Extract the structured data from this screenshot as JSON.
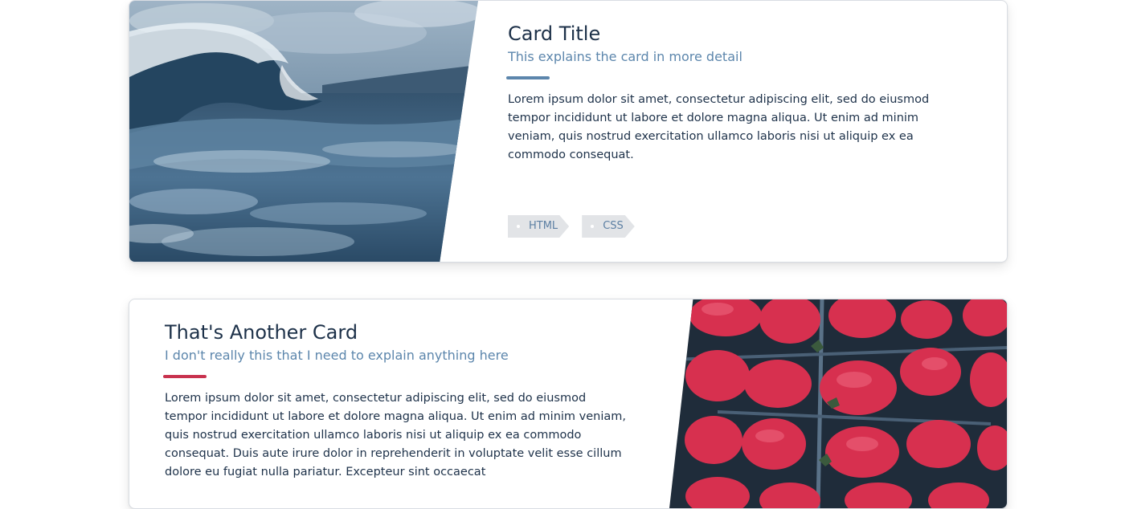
{
  "cards": [
    {
      "title": "Card Title",
      "subtitle": "This explains the card in more detail",
      "description": "Lorem ipsum dolor sit amet, consectetur adipiscing elit, sed do eiusmod tempor incididunt ut labore et dolore magna aliqua. Ut enim ad minim veniam, quis nostrud exercitation ullamco laboris nisi ut aliquip ex ea commodo consequat.",
      "tags": [
        "HTML",
        "CSS"
      ],
      "accent_color": "#5c86ac",
      "image": "ocean-wave-photo"
    },
    {
      "title": "That's Another Card",
      "subtitle": "I don't really this that I need to explain anything here",
      "description": "Lorem ipsum dolor sit amet, consectetur adipiscing elit, sed do eiusmod tempor incididunt ut labore et dolore magna aliqua. Ut enim ad minim veniam, quis nostrud exercitation ullamco laboris nisi ut aliquip ex ea commodo consequat. Duis aute irure dolor in reprehenderit in voluptate velit esse cillum dolore eu fugiat nulla pariatur. Excepteur sint occaecat",
      "accent_color": "#c8324e",
      "image": "strawberries-photo"
    }
  ],
  "colors": {
    "title": "#1d3149",
    "subtitle": "#5c86ac",
    "tag_bg": "#e2e4e7"
  }
}
